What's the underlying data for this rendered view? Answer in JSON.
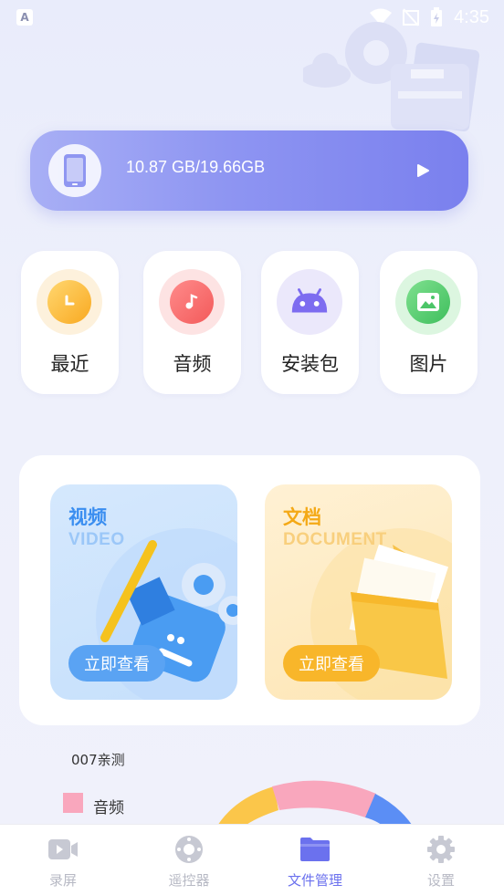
{
  "status_bar": {
    "notif_badge": "A",
    "time": "4:35"
  },
  "storage": {
    "usage_text": "10.87 GB/19.66GB"
  },
  "categories": [
    {
      "label": "最近",
      "icon": "clock-icon"
    },
    {
      "label": "音频",
      "icon": "music-note-icon"
    },
    {
      "label": "安装包",
      "icon": "android-icon"
    },
    {
      "label": "图片",
      "icon": "image-icon"
    }
  ],
  "media": {
    "video": {
      "title": "视频",
      "subtitle": "VIDEO",
      "button": "立即查看"
    },
    "document": {
      "title": "文档",
      "subtitle": "DOCUMENT",
      "button": "立即查看"
    }
  },
  "chart_data": {
    "type": "pie",
    "title": "007亲测",
    "legend": [
      {
        "name": "音频",
        "color": "#f9a7bd"
      }
    ],
    "colors": [
      "#fbc64a",
      "#f9a7bd",
      "#5b8ef5"
    ]
  },
  "tabbar": {
    "items": [
      {
        "label": "录屏",
        "icon": "video-camera-icon"
      },
      {
        "label": "遥控器",
        "icon": "remote-control-icon"
      },
      {
        "label": "文件管理",
        "icon": "folder-icon",
        "active": true
      },
      {
        "label": "设置",
        "icon": "gear-icon"
      }
    ]
  },
  "colors": {
    "accent": "#6b71ee",
    "video": "#3b8ef0",
    "document": "#f4a916"
  }
}
